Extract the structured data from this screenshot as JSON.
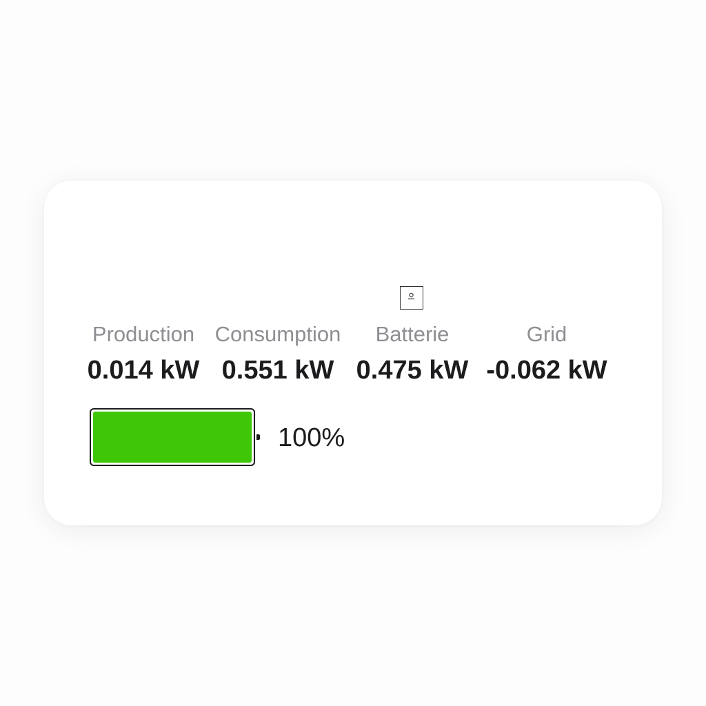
{
  "metrics": {
    "production": {
      "label": "Production",
      "value": "0.014 kW"
    },
    "consumption": {
      "label": "Consumption",
      "value": "0.551 kW"
    },
    "battery": {
      "label": "Batterie",
      "value": "0.475 kW"
    },
    "grid": {
      "label": "Grid",
      "value": "-0.062 kW"
    }
  },
  "battery_status": {
    "percent_text": "100%",
    "level": 1.0,
    "fill_color": "#3fc707"
  },
  "icons": {
    "battery_header": "broken-image-icon"
  }
}
